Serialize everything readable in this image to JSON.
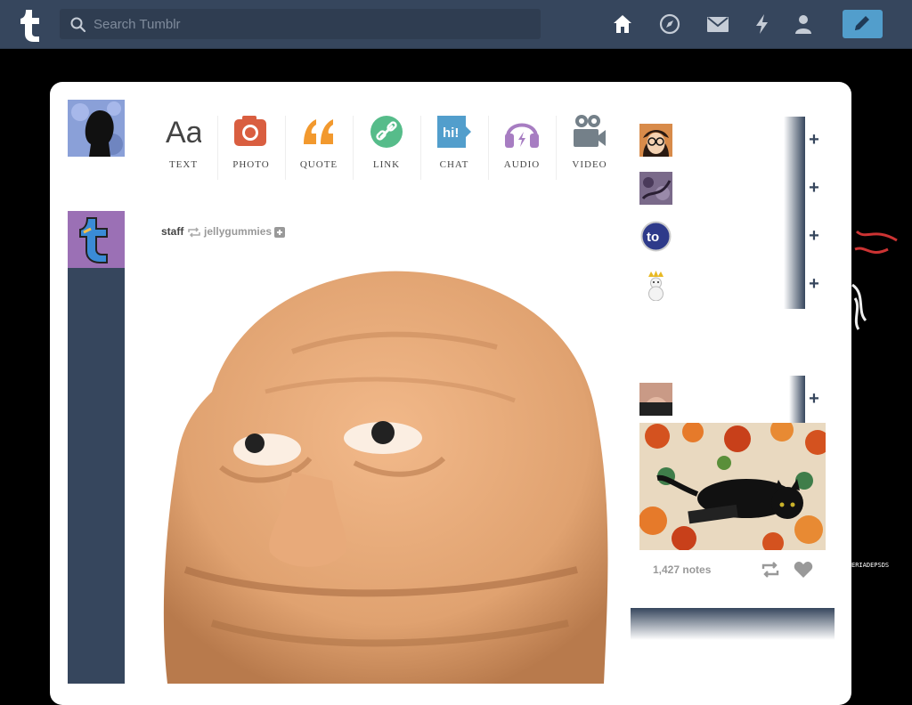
{
  "header": {
    "search_placeholder": "Search Tumblr",
    "nav": [
      "home-icon",
      "explore-icon",
      "inbox-icon",
      "activity-icon",
      "account-icon"
    ],
    "compose_icon": "pencil-icon",
    "accent": "#529ecc",
    "bg": "#36465d"
  },
  "post_types": [
    {
      "label": "TEXT",
      "icon": "text-icon",
      "color": "#444444"
    },
    {
      "label": "PHOTO",
      "icon": "photo-icon",
      "color": "#d95e40"
    },
    {
      "label": "QUOTE",
      "icon": "quote-icon",
      "color": "#f2992e"
    },
    {
      "label": "LINK",
      "icon": "link-icon",
      "color": "#56bc8a"
    },
    {
      "label": "CHAT",
      "icon": "chat-icon",
      "color": "#529ecc"
    },
    {
      "label": "AUDIO",
      "icon": "audio-icon",
      "color": "#a77dc2"
    },
    {
      "label": "VIDEO",
      "icon": "video-icon",
      "color": "#748089"
    }
  ],
  "post": {
    "author": "staff",
    "reblogged_from": "jellygummies"
  },
  "recommended": [
    {
      "avatar": "avatar-glasses"
    },
    {
      "avatar": "avatar-tattoo"
    },
    {
      "avatar": "avatar-to",
      "text": "to"
    },
    {
      "avatar": "avatar-snowman"
    },
    {
      "avatar": "avatar-photo"
    }
  ],
  "radar": {
    "notes": "1,427 notes"
  },
  "side_text": "ERIADEPSDS"
}
